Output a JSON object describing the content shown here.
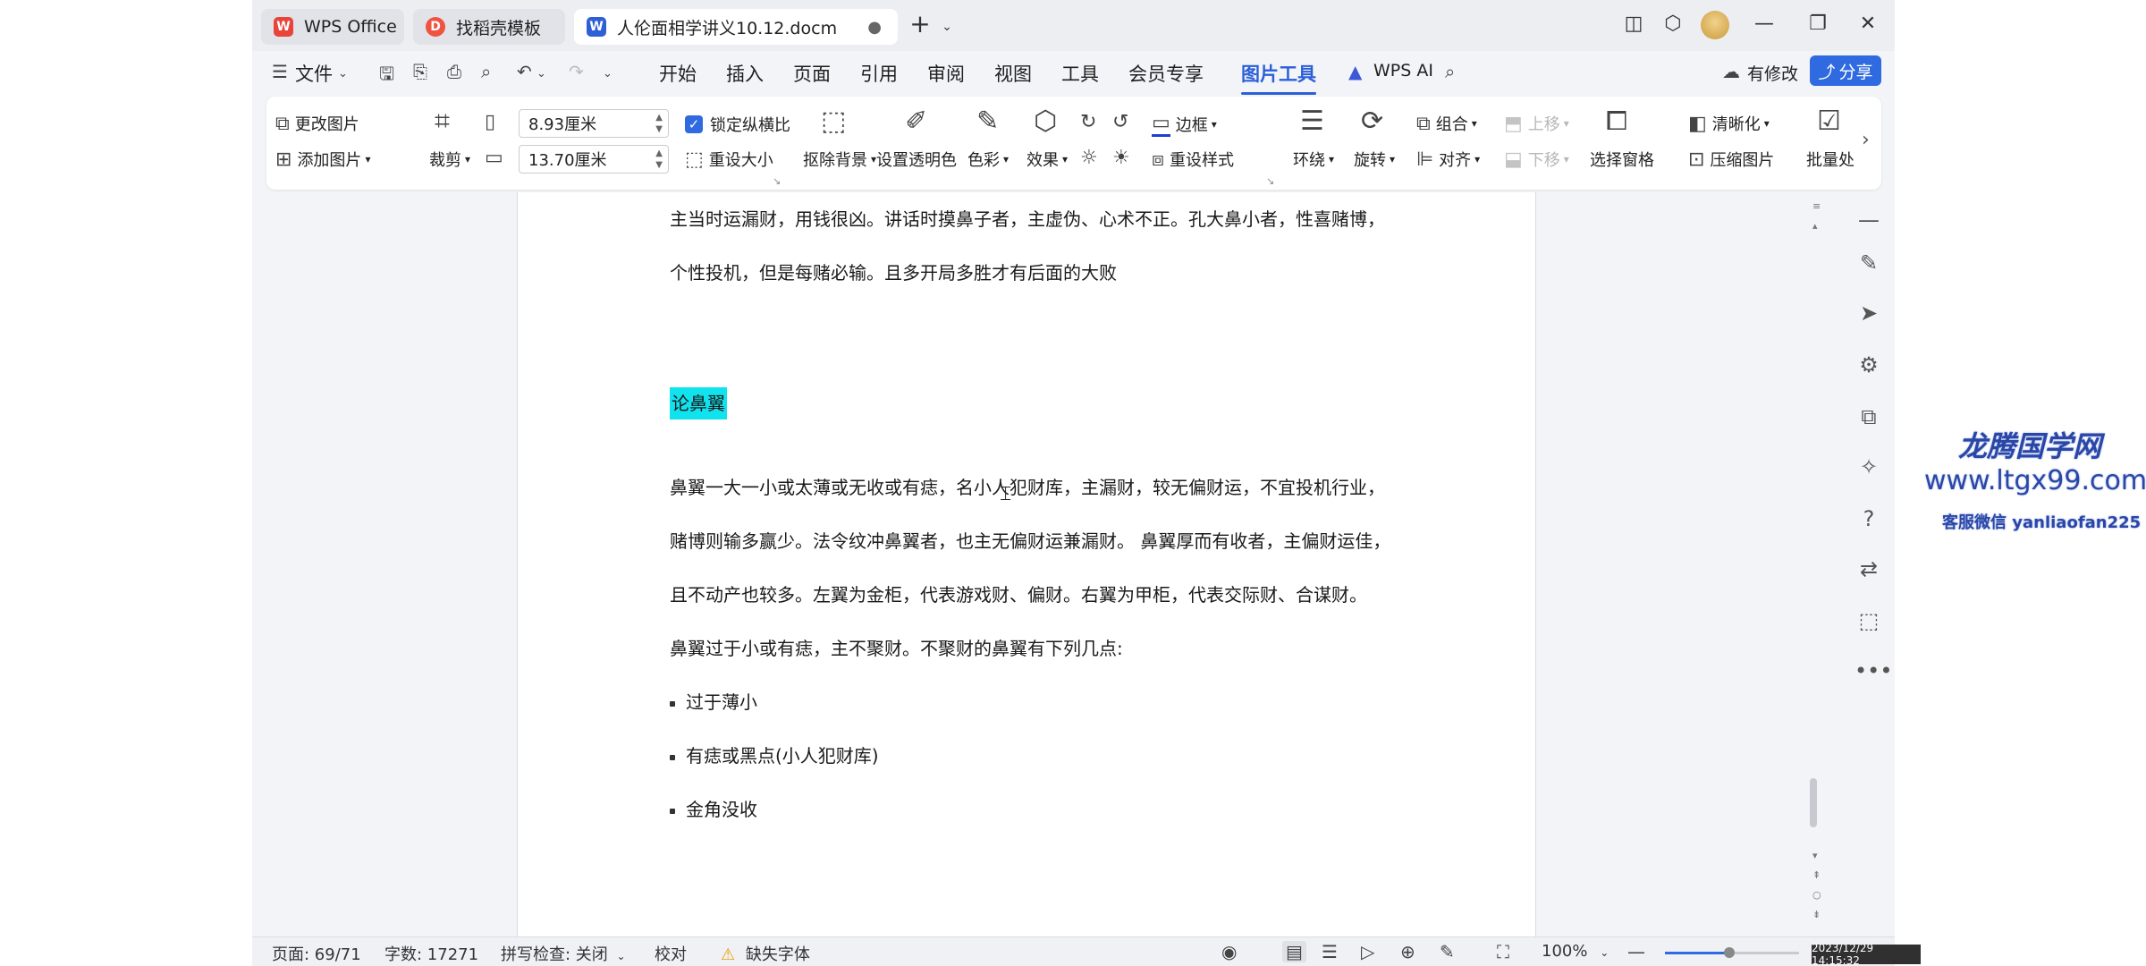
{
  "tabs": [
    {
      "label": "WPS Office",
      "logo": "W"
    },
    {
      "label": "找稻壳模板",
      "logo": "D"
    },
    {
      "label": "人伦面相学讲义10.12.docm",
      "logo": "W"
    }
  ],
  "menubar": {
    "file": "文件",
    "items": [
      "开始",
      "插入",
      "页面",
      "引用",
      "审阅",
      "视图",
      "工具",
      "会员专享",
      "图片工具"
    ],
    "active": "图片工具",
    "wps_ai": "WPS AI",
    "modify": "有修改",
    "share": "分享"
  },
  "ribbon": {
    "change_picture": "更改图片",
    "add_picture": "添加图片",
    "crop": "裁剪",
    "width": "8.93厘米",
    "height": "13.70厘米",
    "lock_ratio": "锁定纵横比",
    "reset_size": "重设大小",
    "remove_bg": "抠除背景",
    "set_transparent": "设置透明色",
    "color": "色彩",
    "effect": "效果",
    "border": "边框",
    "reset_style": "重设样式",
    "wrap": "环绕",
    "rotate": "旋转",
    "group": "组合",
    "align": "对齐",
    "move_up": "上移",
    "move_down": "下移",
    "selection_pane": "选择窗格",
    "sharpen": "清晰化",
    "compress": "压缩图片",
    "batch": "批量处"
  },
  "document": {
    "lines": [
      "主当时运漏财，用钱很凶。讲话时摸鼻子者，主虚伪、心术不正。孔大鼻小者，性喜赌博，",
      "个性投机，但是每赌必输。且多开局多胜才有后面的大败"
    ],
    "heading": "论鼻翼",
    "paragraph": [
      "鼻翼一大一小或太薄或无收或有痣，名小人犯财库，主漏财，较无偏财运，不宜投机行业，",
      "赌博则输多赢少。法令纹冲鼻翼者，也主无偏财运兼漏财。 鼻翼厚而有收者，主偏财运佳，",
      "且不动产也较多。左翼为金柜，代表游戏财、偏财。右翼为甲柜，代表交际财、合谋财。",
      "鼻翼过于小或有痣，主不聚财。不聚财的鼻翼有下列几点:"
    ],
    "bullets": [
      "过于薄小",
      "有痣或黑点(小人犯财库)",
      "金角没收"
    ]
  },
  "statusbar": {
    "page": "页面: 69/71",
    "words": "字数: 17271",
    "spellcheck": "拼写检查: 关闭",
    "proofread": "校对",
    "missing_font": "缺失字体",
    "zoom": "100%",
    "zoom_level_pct": 48
  },
  "timestamp": "2023/12/29 14:15:32",
  "watermark": {
    "title": "龙腾国学网",
    "url": "www.ltgx99.com",
    "contact": "客服微信 yanliaofan225"
  },
  "colors": {
    "accent": "#2f6ae0",
    "highlight": "#11e3ee",
    "wps_red": "#e8443a",
    "docer_red": "#f0533f",
    "word_blue": "#2f5fd6"
  }
}
